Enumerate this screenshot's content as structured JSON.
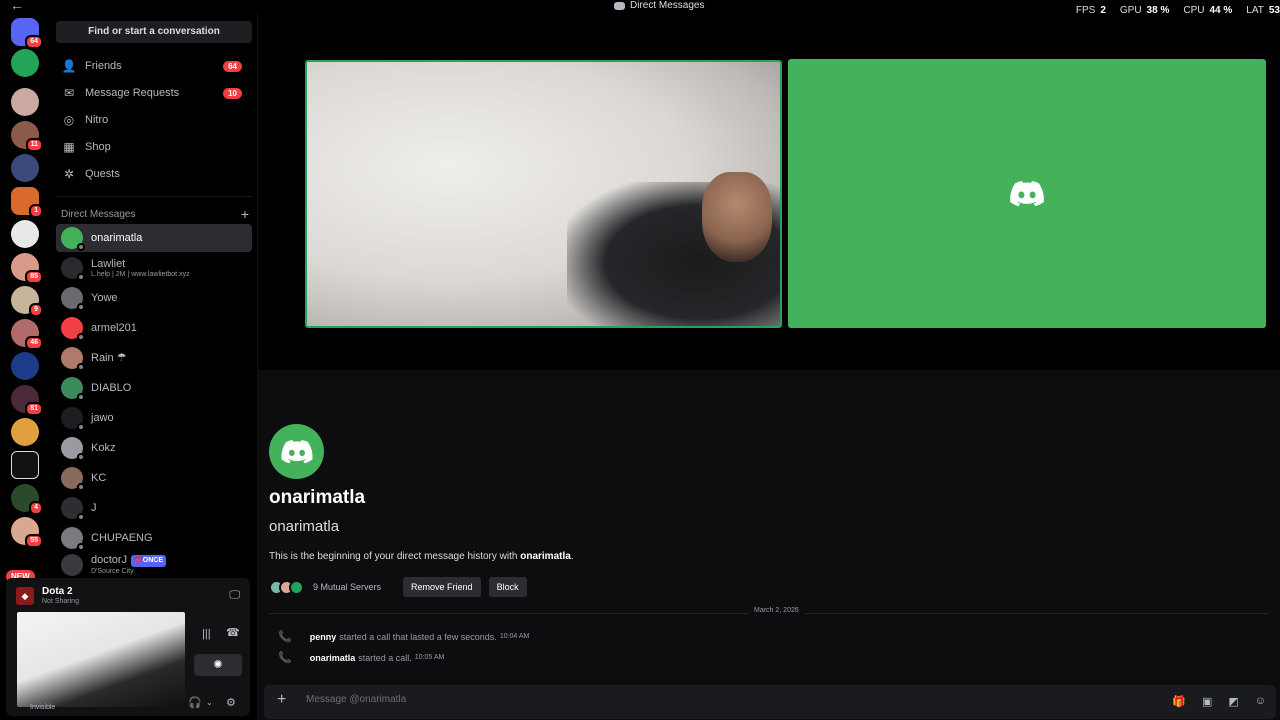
{
  "topbar": {
    "title": "Direct Messages"
  },
  "hud": [
    {
      "label": "FPS",
      "value": "2"
    },
    {
      "label": "GPU",
      "value": "38 %"
    },
    {
      "label": "CPU",
      "value": "44 %"
    },
    {
      "label": "LAT",
      "value": "53"
    }
  ],
  "rail": {
    "home_badge": "64",
    "badges": [
      "11",
      "1",
      "85",
      "9",
      "46",
      "81",
      "4",
      "55"
    ],
    "new_label": "NEW"
  },
  "sidebar": {
    "search_label": "Find or start a conversation",
    "nav": [
      {
        "label": "Friends",
        "icon": "friends-icon",
        "count": "64"
      },
      {
        "label": "Message Requests",
        "icon": "mail-icon",
        "count": "10"
      },
      {
        "label": "Nitro",
        "icon": "nitro-icon",
        "count": ""
      },
      {
        "label": "Shop",
        "icon": "shop-icon",
        "count": ""
      },
      {
        "label": "Quests",
        "icon": "quests-icon",
        "count": ""
      }
    ],
    "dm_header": "Direct Messages",
    "dms": [
      {
        "name": "onarimatla",
        "sub": "",
        "tag": ""
      },
      {
        "name": "Lawliet",
        "sub": "L.help | 2M | www.lawlietbot.xyz",
        "tag": ""
      },
      {
        "name": "Yowe",
        "sub": "",
        "tag": ""
      },
      {
        "name": "armel201",
        "sub": "",
        "tag": ""
      },
      {
        "name": "Rain ☂",
        "sub": "",
        "tag": ""
      },
      {
        "name": "DIABLO",
        "sub": "",
        "tag": ""
      },
      {
        "name": "jawo",
        "sub": "",
        "tag": ""
      },
      {
        "name": "Kokz",
        "sub": "",
        "tag": ""
      },
      {
        "name": "KC",
        "sub": "",
        "tag": ""
      },
      {
        "name": "J",
        "sub": "",
        "tag": ""
      },
      {
        "name": "CHUPAENG",
        "sub": "",
        "tag": ""
      },
      {
        "name": "doctorJ",
        "sub": "D'Source City",
        "tag": "💗ONCE"
      }
    ]
  },
  "voice": {
    "game_title": "Dota 2",
    "game_status": "Not Sharing",
    "status": "Invisible"
  },
  "profile": {
    "display_name": "onarimatla",
    "username": "onarimatla",
    "intro_prefix": "This is the beginning of your direct message history with ",
    "intro_name": "onarimatla",
    "intro_suffix": ".",
    "mutual": "9 Mutual Servers",
    "remove_friend": "Remove Friend",
    "block": "Block"
  },
  "messages": {
    "date": "March 2, 2026",
    "items": [
      {
        "author": "penny",
        "text": "started a call that lasted a few seconds.",
        "time": "10:04 AM"
      },
      {
        "author": "onarimatla",
        "text": "started a call.",
        "time": "10:05 AM"
      }
    ]
  },
  "composer": {
    "placeholder": "Message @onarimatla"
  },
  "colors": {
    "accent_green": "#43b25a",
    "badge_red": "#f23f43",
    "call_green": "#23a559"
  }
}
